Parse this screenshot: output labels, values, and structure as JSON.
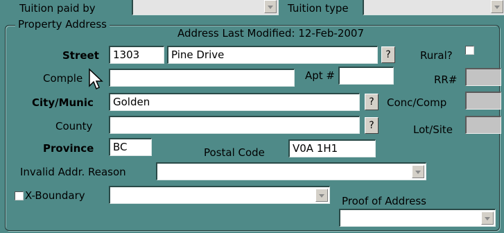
{
  "top": {
    "tuition_paid_by_label": "Tuition paid by",
    "tuition_paid_by_value": "",
    "tuition_type_label": "Tuition type",
    "tuition_type_value": ""
  },
  "property": {
    "group_title": "Property Address",
    "last_modified": "Address Last Modified: 12-Feb-2007",
    "street_label": "Street",
    "street_number": "1303",
    "street_name": "Pine Drive",
    "help_glyph": "?",
    "rural_label": "Rural?",
    "complex_label": "Comple",
    "complex_value": "",
    "apt_label": "Apt #",
    "apt_value": "",
    "rr_label": "RR#",
    "city_label": "City/Munic",
    "city_value": "Golden",
    "conc_label": "Conc/Comp",
    "county_label": "County",
    "county_value": "",
    "lot_label": "Lot/Site",
    "province_label": "Province",
    "province_value": "BC",
    "postal_label": "Postal Code",
    "postal_value": "V0A 1H1",
    "invalid_label": "Invalid Addr. Reason",
    "invalid_value": "",
    "xboundary_label": "X-Boundary",
    "xboundary_value": "",
    "proof_label": "Proof of Address",
    "proof_value": ""
  },
  "colors": {
    "background": "#4f8a88",
    "readonly_field": "#c3c3c3"
  },
  "icons": {
    "cursor": "mouse-pointer-icon",
    "dropdown": "chevron-down-icon"
  }
}
